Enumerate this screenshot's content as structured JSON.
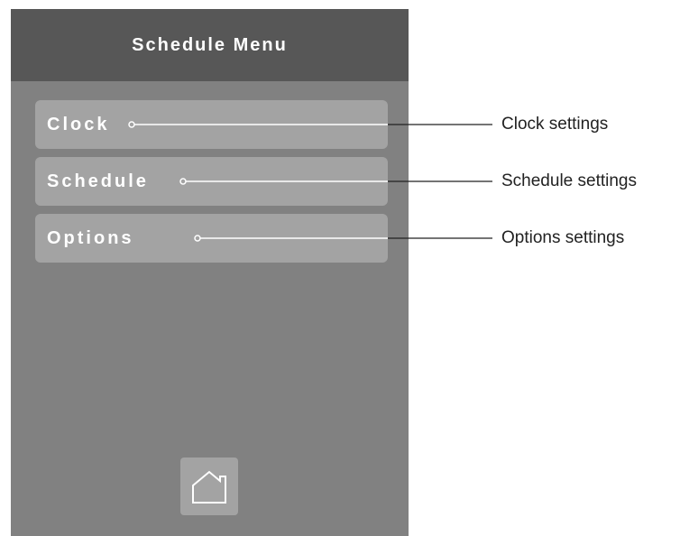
{
  "header": {
    "title": "Schedule Menu"
  },
  "menu": {
    "items": [
      {
        "label": "Clock"
      },
      {
        "label": "Schedule"
      },
      {
        "label": "Options"
      }
    ]
  },
  "footer": {
    "home_icon": "home-icon"
  },
  "callouts": [
    {
      "label": "Clock settings"
    },
    {
      "label": "Schedule settings"
    },
    {
      "label": "Options settings"
    }
  ],
  "colors": {
    "device_background": "#818181",
    "title_bar": "#575757",
    "button": "#a3a3a3",
    "text_on_device": "#ffffff",
    "callout_text": "#222222"
  }
}
